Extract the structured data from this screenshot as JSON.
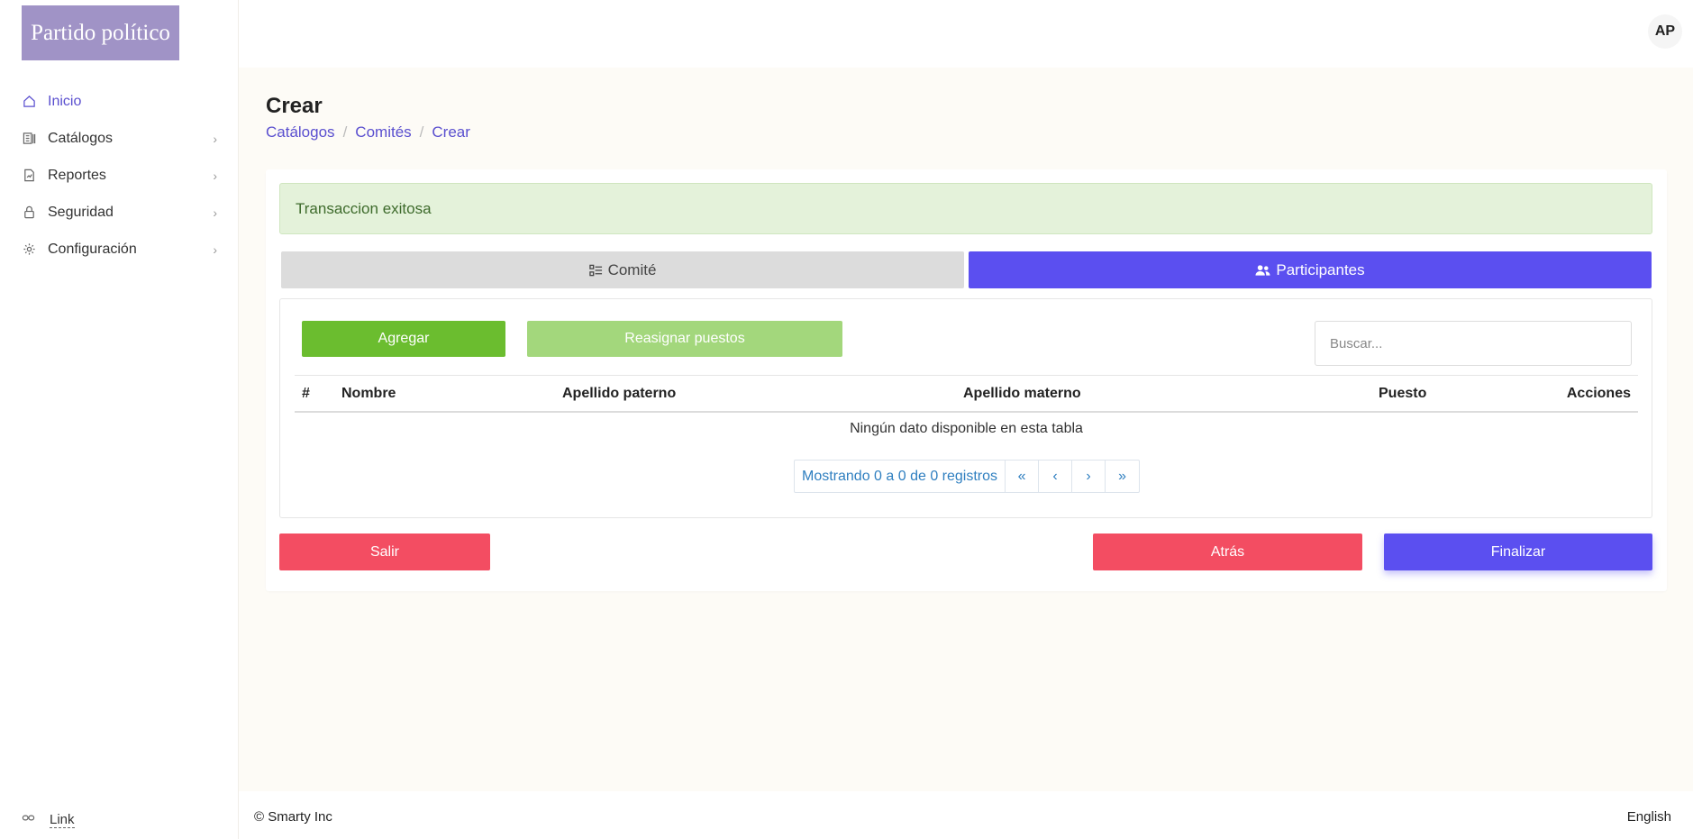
{
  "brand": {
    "logo_text": "Partido político",
    "logo_color": "#a093c6"
  },
  "user": {
    "initials": "AP"
  },
  "sidebar": {
    "items": [
      {
        "label": "Inicio",
        "icon": "home-icon",
        "active": true
      },
      {
        "label": "Catálogos",
        "icon": "catalog-icon"
      },
      {
        "label": "Reportes",
        "icon": "report-icon"
      },
      {
        "label": "Seguridad",
        "icon": "lock-icon"
      },
      {
        "label": "Configuración",
        "icon": "gear-icon"
      }
    ],
    "bottom_link": "Link"
  },
  "page": {
    "title": "Crear",
    "breadcrumb": [
      "Catálogos",
      "Comités",
      "Crear"
    ]
  },
  "alert": {
    "message": "Transaccion exitosa"
  },
  "tabs": [
    {
      "label": "Comité",
      "icon": "list-check-icon",
      "active": false
    },
    {
      "label": "Participantes",
      "icon": "users-icon",
      "active": true
    }
  ],
  "toolbar": {
    "add_label": "Agregar",
    "reassign_label": "Reasignar puestos",
    "search_placeholder": "Buscar..."
  },
  "table": {
    "columns": [
      "#",
      "Nombre",
      "Apellido paterno",
      "Apellido materno",
      "Puesto",
      "Acciones"
    ],
    "rows": [],
    "empty_message": "Ningún dato disponible en esta tabla"
  },
  "pagination": {
    "info": "Mostrando 0 a 0 de 0 registros",
    "first": "«",
    "prev": "‹",
    "next": "›",
    "last": "»"
  },
  "actions": {
    "exit_label": "Salir",
    "back_label": "Atrás",
    "finish_label": "Finalizar"
  },
  "footer": {
    "copyright": "© Smarty Inc",
    "language": "English"
  },
  "colors": {
    "accent": "#5b4ff0",
    "success": "#6bbd2f",
    "danger": "#f34d62",
    "alert_bg": "#e4f2da"
  }
}
